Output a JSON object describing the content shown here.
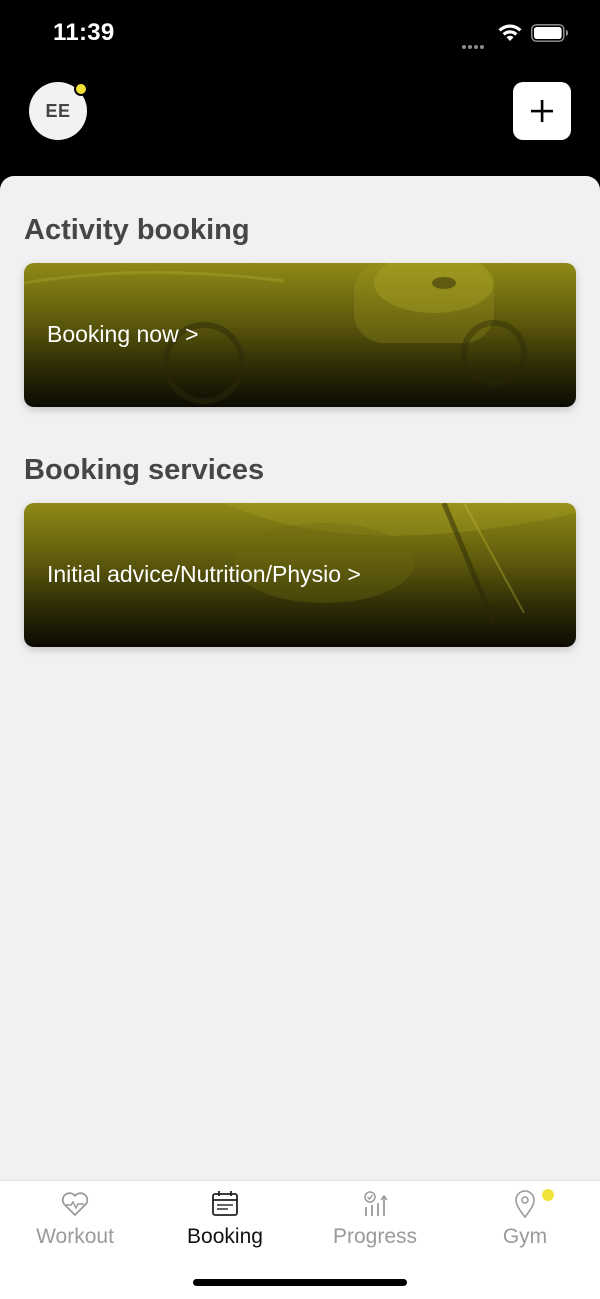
{
  "status_bar": {
    "time": "11:39",
    "icons": [
      "signal-dots-icon",
      "wifi-icon",
      "battery-icon"
    ]
  },
  "header": {
    "avatar_initials": "EE",
    "avatar_badge_color": "#f1e238",
    "add_icon": "plus-icon"
  },
  "sections": [
    {
      "title": "Activity booking",
      "card_label": "Booking now >"
    },
    {
      "title": "Booking services",
      "card_label": "Initial advice/Nutrition/Physio >"
    }
  ],
  "tabs": [
    {
      "label": "Workout",
      "icon": "heart-icon",
      "active": false
    },
    {
      "label": "Booking",
      "icon": "calendar-icon",
      "active": true
    },
    {
      "label": "Progress",
      "icon": "progress-chart-icon",
      "active": false
    },
    {
      "label": "Gym",
      "icon": "location-pin-icon",
      "active": false
    }
  ],
  "colors": {
    "accent": "#f1e238",
    "background": "#f1f1f1",
    "header": "#000000"
  }
}
